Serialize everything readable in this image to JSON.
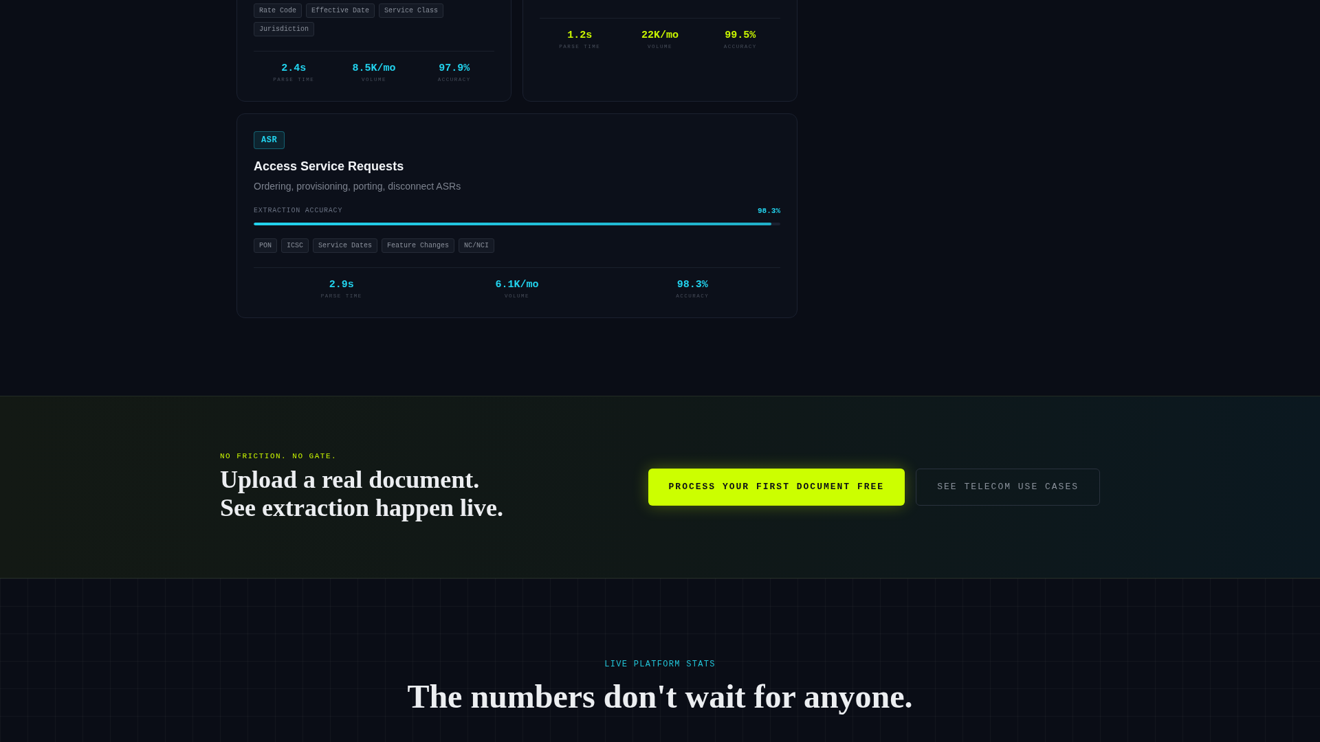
{
  "cards": [
    {
      "color": "#22d3ee",
      "tags": [
        "Rate Code",
        "Effective Date",
        "Service Class",
        "Jurisdiction"
      ],
      "stats": [
        {
          "value": "2.4s",
          "label": "PARSE TIME"
        },
        {
          "value": "8.5K/mo",
          "label": "VOLUME"
        },
        {
          "value": "97.9%",
          "label": "ACCURACY"
        }
      ]
    },
    {
      "color": "#c8f400",
      "stats": [
        {
          "value": "1.2s",
          "label": "PARSE TIME"
        },
        {
          "value": "22K/mo",
          "label": "VOLUME"
        },
        {
          "value": "99.5%",
          "label": "ACCURACY"
        }
      ]
    },
    {
      "color": "#22d3ee",
      "badge": "ASR",
      "title": "Access Service Requests",
      "subtitle": "Ordering, provisioning, porting, disconnect ASRs",
      "meter": {
        "label": "EXTRACTION ACCURACY",
        "reading": "98.3%",
        "level": 0.983
      },
      "tags": [
        "PON",
        "ICSC",
        "Service Dates",
        "Feature Changes",
        "NC/NCI"
      ],
      "stats": [
        {
          "value": "2.9s",
          "label": "PARSE TIME"
        },
        {
          "value": "6.1K/mo",
          "label": "VOLUME"
        },
        {
          "value": "98.3%",
          "label": "ACCURACY"
        }
      ]
    }
  ],
  "cta": {
    "eyebrow": "NO FRICTION. NO GATE.",
    "heading": [
      "Upload a real document.",
      "See extraction happen live."
    ],
    "buttons": [
      {
        "kind": "primary",
        "label": "PROCESS YOUR FIRST DOCUMENT FREE"
      },
      {
        "kind": "secondary",
        "label": "SEE TELECOM USE CASES"
      }
    ]
  },
  "stats_section": {
    "eyebrow": "LIVE PLATFORM STATS",
    "heading": "The numbers don't wait for anyone."
  }
}
